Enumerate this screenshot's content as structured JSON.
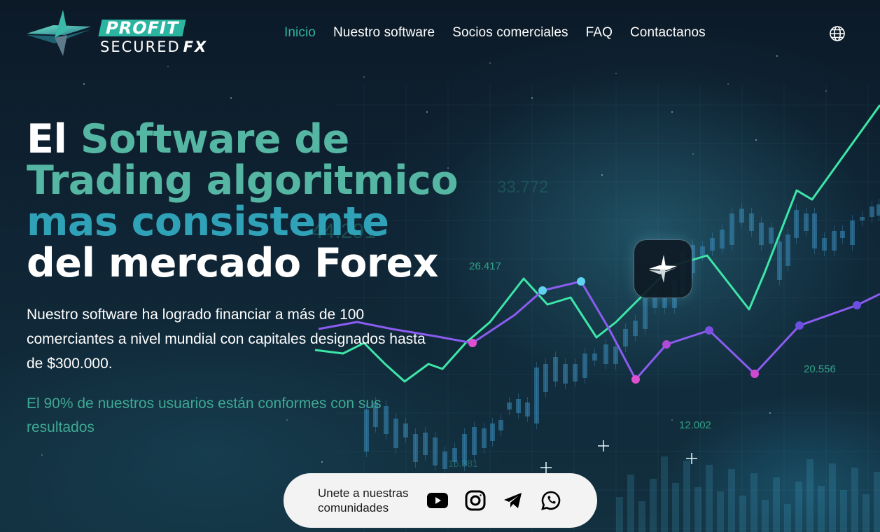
{
  "brand": {
    "word1": "PROFIT",
    "word2": "SECURED",
    "word3": "FX"
  },
  "nav": {
    "items": [
      {
        "label": "Inicio",
        "active": true
      },
      {
        "label": "Nuestro software",
        "active": false
      },
      {
        "label": "Socios comerciales",
        "active": false
      },
      {
        "label": "FAQ",
        "active": false
      },
      {
        "label": "Contactanos",
        "active": false
      }
    ],
    "language_icon": "globe-icon"
  },
  "hero": {
    "title_part1": "El ",
    "title_part2": "Software de Trading algoritmico ",
    "title_part3": "mas consistente",
    "title_part4": " del mercado Forex",
    "description": "Nuestro software ha logrado financiar a más de 100 comerciantes a nivel mundial con capitales designados hasta de $300.000.",
    "stat": "El 90% de nuestros usuarios están conformes con sus resultados"
  },
  "background_numbers": [
    "33.772",
    "44.291",
    "26.417",
    "20.556",
    "12.002",
    "16.381"
  ],
  "community": {
    "label": "Unete a nuestras comunidades",
    "icons": [
      "youtube-icon",
      "instagram-icon",
      "telegram-icon",
      "whatsapp-icon"
    ]
  },
  "colors": {
    "accent_teal": "#2fb5a0",
    "line_green": "#3de6a8",
    "line_purple": "#7b5cf0",
    "point_pink": "#e04fd0"
  }
}
